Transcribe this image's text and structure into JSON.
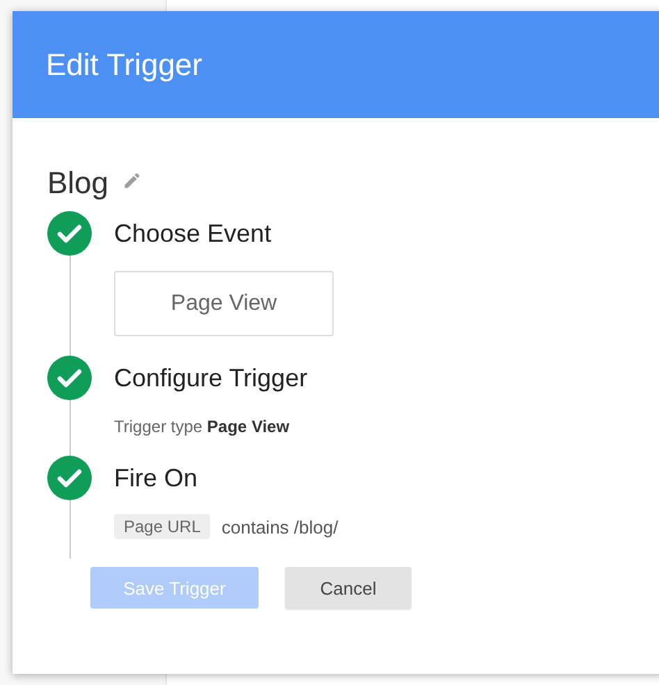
{
  "dialog": {
    "title": "Edit Trigger",
    "name": "Blog"
  },
  "steps": [
    {
      "title": "Choose Event",
      "complete": true,
      "kind": "event",
      "value": "Page View"
    },
    {
      "title": "Configure Trigger",
      "complete": true,
      "kind": "type",
      "text": "Trigger type **Page View**"
    },
    {
      "title": "Fire On",
      "complete": true,
      "kind": "condition",
      "variable": "Page URL",
      "condition": "contains /blog/"
    }
  ],
  "buttons": {
    "save": {
      "label": "Save Trigger",
      "disabled": true
    },
    "cancel": {
      "label": "Cancel"
    }
  }
}
